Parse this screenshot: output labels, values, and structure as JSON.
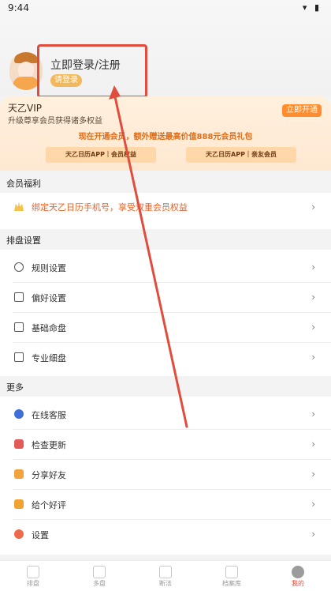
{
  "status": {
    "time": "9:44",
    "icons_label": "▾ ▮"
  },
  "profile": {
    "login_title": "立即登录/注册",
    "login_button": "请登录"
  },
  "vip": {
    "name": "天乙VIP",
    "subtitle": "升级尊享会员获得诸多权益",
    "open_button": "立即开通",
    "promo": "现在开通会员，额外赠送最高价值888元会员礼包",
    "card1": "天乙日历APP｜会员权益",
    "card2": "天乙日历APP｜亲友会员"
  },
  "sections": {
    "member_benefits": "会员福利",
    "layout_settings": "排盘设置",
    "more": "更多"
  },
  "member_benefits": {
    "bind_text": "绑定天乙日历手机号，享受双重会员权益"
  },
  "layout_items": [
    {
      "label": "规则设置"
    },
    {
      "label": "偏好设置"
    },
    {
      "label": "基础命盘"
    },
    {
      "label": "专业细盘"
    }
  ],
  "more_items": [
    {
      "label": "在线客服",
      "color": "#3f6ed8"
    },
    {
      "label": "检查更新",
      "color": "#e35b58"
    },
    {
      "label": "分享好友",
      "color": "#f2a33b"
    },
    {
      "label": "给个好评",
      "color": "#f0a12f"
    },
    {
      "label": "设置",
      "color": "#ef6a4c"
    }
  ],
  "bottom_nav": [
    {
      "label": "排盘"
    },
    {
      "label": "多盘"
    },
    {
      "label": "断法"
    },
    {
      "label": "档案库"
    },
    {
      "label": "我的"
    }
  ],
  "colors": {
    "accent": "#e14d3c",
    "vip_orange": "#ff8d2d"
  }
}
